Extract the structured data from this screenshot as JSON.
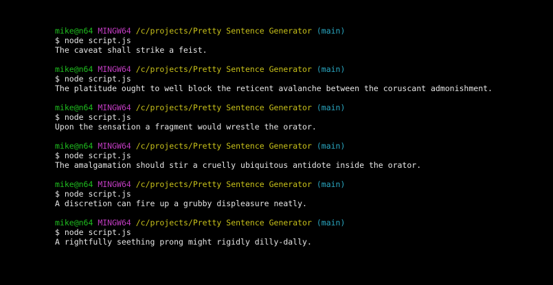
{
  "terminal": {
    "sessions": [
      {
        "user": "mike@n64",
        "system": "MINGW64",
        "path": "/c/projects/Pretty Sentence Generator",
        "branch": "(main)",
        "prompt_symbol": "$",
        "command": "node script.js",
        "output": "The caveat shall strike a feist."
      },
      {
        "user": "mike@n64",
        "system": "MINGW64",
        "path": "/c/projects/Pretty Sentence Generator",
        "branch": "(main)",
        "prompt_symbol": "$",
        "command": "node script.js",
        "output": "The platitude ought to well block the reticent avalanche between the coruscant admonishment."
      },
      {
        "user": "mike@n64",
        "system": "MINGW64",
        "path": "/c/projects/Pretty Sentence Generator",
        "branch": "(main)",
        "prompt_symbol": "$",
        "command": "node script.js",
        "output": "Upon the sensation a fragment would wrestle the orator."
      },
      {
        "user": "mike@n64",
        "system": "MINGW64",
        "path": "/c/projects/Pretty Sentence Generator",
        "branch": "(main)",
        "prompt_symbol": "$",
        "command": "node script.js",
        "output": "The amalgamation should stir a cruelly ubiquitous antidote inside the orator."
      },
      {
        "user": "mike@n64",
        "system": "MINGW64",
        "path": "/c/projects/Pretty Sentence Generator",
        "branch": "(main)",
        "prompt_symbol": "$",
        "command": "node script.js",
        "output": "A discretion can fire up a grubby displeasure neatly."
      },
      {
        "user": "mike@n64",
        "system": "MINGW64",
        "path": "/c/projects/Pretty Sentence Generator",
        "branch": "(main)",
        "prompt_symbol": "$",
        "command": "node script.js",
        "output": "A rightfully seething prong might rigidly dilly-dally."
      }
    ]
  },
  "colors": {
    "background": "#000000",
    "user": "#1fbf1f",
    "system": "#c23cc2",
    "path": "#c9c21a",
    "branch": "#2aa8c2",
    "text": "#e6e6e6"
  }
}
